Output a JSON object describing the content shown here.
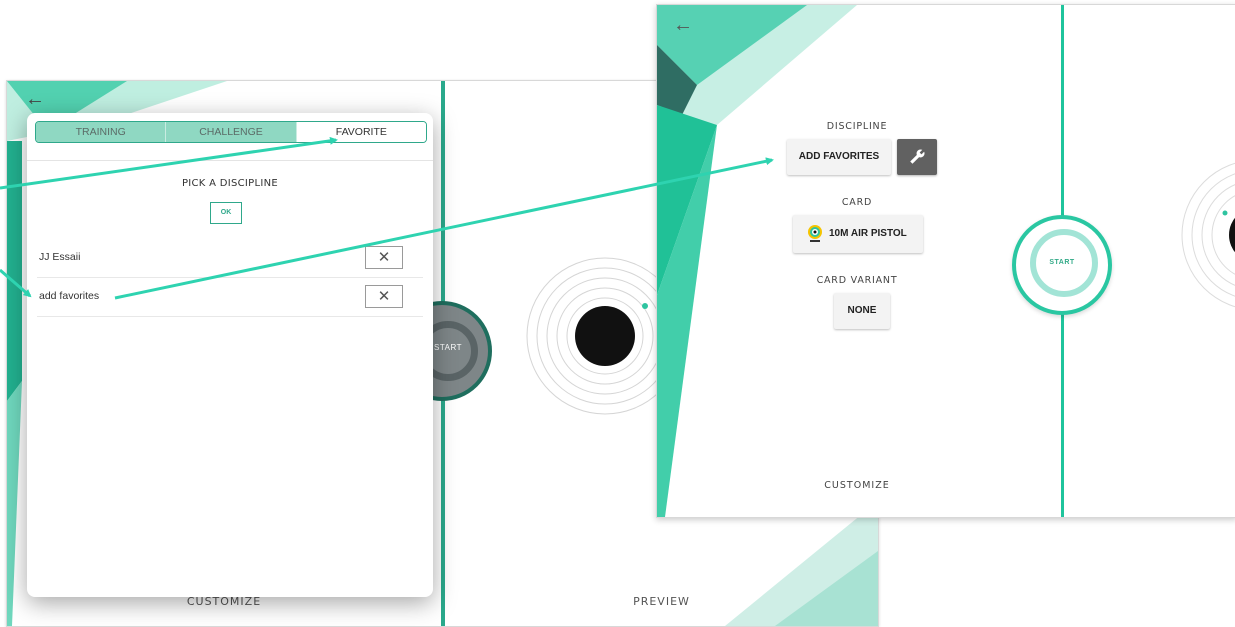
{
  "colors": {
    "accent": "#2ec4a0",
    "accent_dark": "#1f6e5e",
    "tab_inactive": "#8fd8c2",
    "arrow": "#2ed3b0"
  },
  "left_screen": {
    "back_icon": "arrow-left-icon",
    "modal": {
      "tabs": [
        "TRAINING",
        "CHALLENGE",
        "FAVORITE"
      ],
      "active_tab": "FAVORITE",
      "title": "PICK A DISCIPLINE",
      "ok_label": "OK",
      "favorites": [
        {
          "name": "JJ Essaii",
          "delete_icon": "close-icon"
        },
        {
          "name": "add favorites",
          "delete_icon": "close-icon"
        }
      ]
    },
    "start_label": "START",
    "customize_label": "CUSTOMIZE",
    "preview_label": "PREVIEW"
  },
  "right_screen": {
    "back_icon": "arrow-left-icon",
    "discipline_label": "DISCIPLINE",
    "discipline_button": "ADD FAVORITES",
    "settings_icon": "wrench-icon",
    "card_label": "CARD",
    "card_button": "10M AIR PISTOL",
    "card_icon": "issf-target-icon",
    "card_variant_label": "CARD VARIANT",
    "card_variant_button": "NONE",
    "start_label": "START",
    "customize_label": "CUSTOMIZE"
  }
}
